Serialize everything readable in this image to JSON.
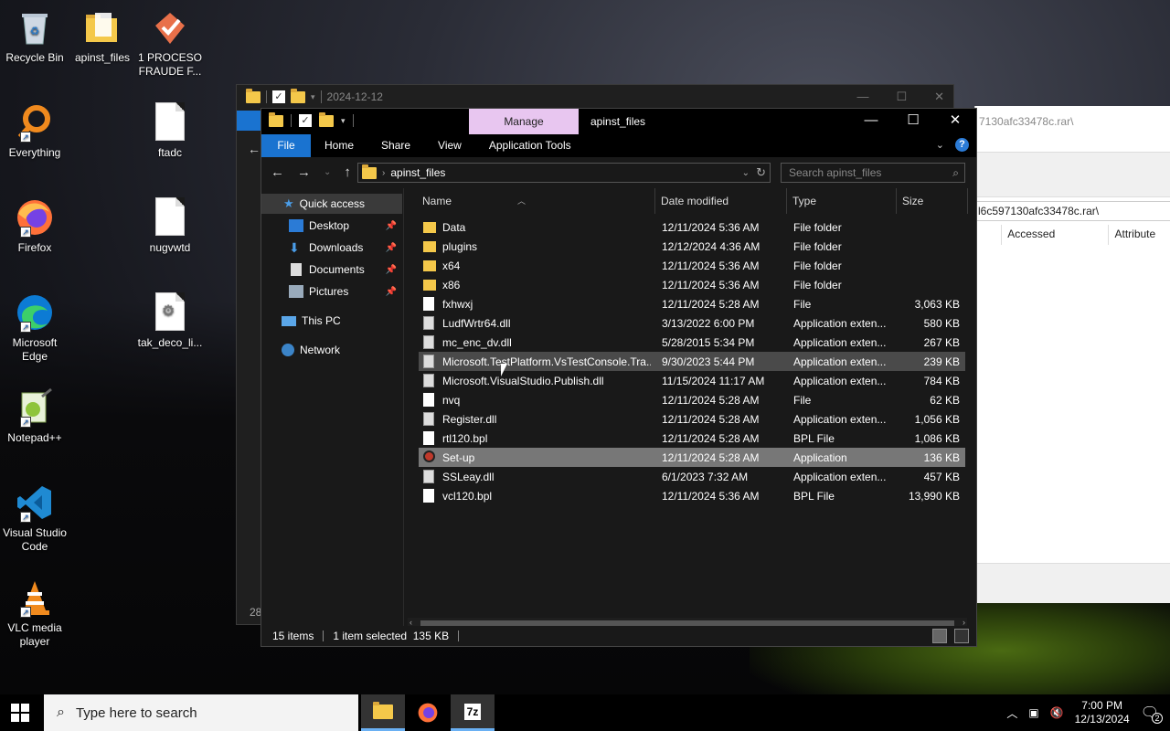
{
  "desktop": {
    "icons": [
      {
        "label": "Recycle Bin"
      },
      {
        "label": "apinst_files"
      },
      {
        "label": "1 PROCESO FRAUDE F..."
      },
      {
        "label": "Everything"
      },
      {
        "label": "ftadc"
      },
      {
        "label": "Firefox"
      },
      {
        "label": "nugvwtd"
      },
      {
        "label": "Microsoft Edge"
      },
      {
        "label": "tak_deco_li..."
      },
      {
        "label": "Notepad++"
      },
      {
        "label": "Visual Studio Code"
      },
      {
        "label": "VLC media player"
      }
    ]
  },
  "bg_window": {
    "title": "2024-12-12",
    "status_count": "28"
  },
  "right_window": {
    "path_top": "7130afc33478c.rar\\",
    "path": "l6c597130afc33478c.rar\\",
    "col_accessed": "Accessed",
    "col_attributes": "Attribute"
  },
  "explorer": {
    "manage_tab": "Manage",
    "title": "apinst_files",
    "ribbon_tabs": [
      "File",
      "Home",
      "Share",
      "View",
      "Application Tools"
    ],
    "address": "apinst_files",
    "search_placeholder": "Search apinst_files",
    "nav": {
      "quick_access": "Quick access",
      "desktop": "Desktop",
      "downloads": "Downloads",
      "documents": "Documents",
      "pictures": "Pictures",
      "this_pc": "This PC",
      "network": "Network"
    },
    "columns": {
      "name": "Name",
      "date": "Date modified",
      "type": "Type",
      "size": "Size"
    },
    "files": [
      {
        "name": "Data",
        "date": "12/11/2024 5:36 AM",
        "type": "File folder",
        "size": "",
        "kind": "folder"
      },
      {
        "name": "plugins",
        "date": "12/12/2024 4:36 AM",
        "type": "File folder",
        "size": "",
        "kind": "folder"
      },
      {
        "name": "x64",
        "date": "12/11/2024 5:36 AM",
        "type": "File folder",
        "size": "",
        "kind": "folder"
      },
      {
        "name": "x86",
        "date": "12/11/2024 5:36 AM",
        "type": "File folder",
        "size": "",
        "kind": "folder"
      },
      {
        "name": "fxhwxj",
        "date": "12/11/2024 5:28 AM",
        "type": "File",
        "size": "3,063 KB",
        "kind": "file"
      },
      {
        "name": "LudfWrtr64.dll",
        "date": "3/13/2022 6:00 PM",
        "type": "Application exten...",
        "size": "580 KB",
        "kind": "dll"
      },
      {
        "name": "mc_enc_dv.dll",
        "date": "5/28/2015 5:34 PM",
        "type": "Application exten...",
        "size": "267 KB",
        "kind": "dll"
      },
      {
        "name": "Microsoft.TestPlatform.VsTestConsole.Tra...",
        "date": "9/30/2023 5:44 PM",
        "type": "Application exten...",
        "size": "239 KB",
        "kind": "dll"
      },
      {
        "name": "Microsoft.VisualStudio.Publish.dll",
        "date": "11/15/2024 11:17 AM",
        "type": "Application exten...",
        "size": "784 KB",
        "kind": "dll"
      },
      {
        "name": "nvq",
        "date": "12/11/2024 5:28 AM",
        "type": "File",
        "size": "62 KB",
        "kind": "file"
      },
      {
        "name": "Register.dll",
        "date": "12/11/2024 5:28 AM",
        "type": "Application exten...",
        "size": "1,056 KB",
        "kind": "dll"
      },
      {
        "name": "rtl120.bpl",
        "date": "12/11/2024 5:28 AM",
        "type": "BPL File",
        "size": "1,086 KB",
        "kind": "file"
      },
      {
        "name": "Set-up",
        "date": "12/11/2024 5:28 AM",
        "type": "Application",
        "size": "136 KB",
        "kind": "app"
      },
      {
        "name": "SSLeay.dll",
        "date": "6/1/2023 7:32 AM",
        "type": "Application exten...",
        "size": "457 KB",
        "kind": "dll"
      },
      {
        "name": "vcl120.bpl",
        "date": "12/11/2024 5:36 AM",
        "type": "BPL File",
        "size": "13,990 KB",
        "kind": "file"
      }
    ],
    "status": {
      "items": "15 items",
      "selected": "1 item selected  135 KB"
    }
  },
  "taskbar": {
    "search_placeholder": "Type here to search",
    "time": "7:00 PM",
    "date": "12/13/2024",
    "notifications": "2"
  },
  "colors": {
    "accent": "#1a73d0",
    "manage": "#e8c6f0",
    "selected_row": "#777777"
  }
}
